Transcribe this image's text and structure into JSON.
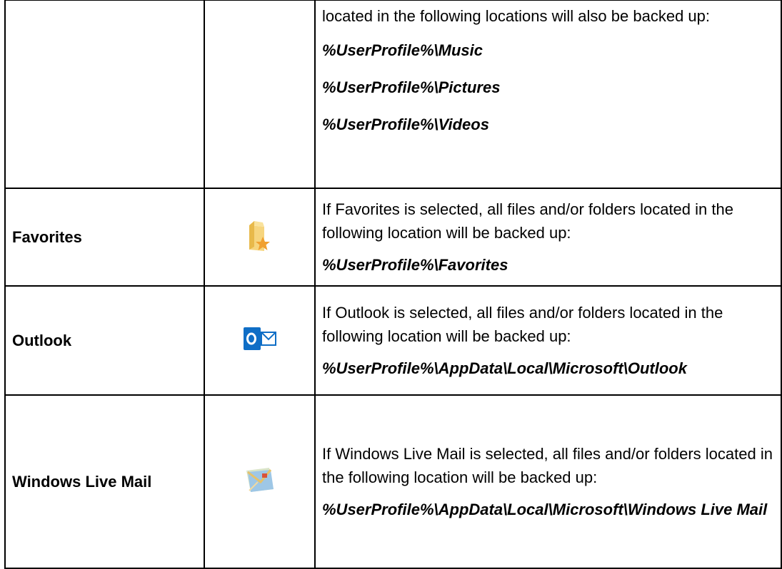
{
  "rows": [
    {
      "name": "",
      "icon": "",
      "description": "located in the following locations will also be backed up:",
      "paths": [
        "%UserProfile%\\Music",
        "%UserProfile%\\Pictures",
        "%UserProfile%\\Videos"
      ]
    },
    {
      "name": "Favorites",
      "icon": "favorites-folder-icon",
      "description": "If Favorites is selected, all files and/or folders located in the following location will be backed up:",
      "paths": [
        "%UserProfile%\\Favorites"
      ]
    },
    {
      "name": "Outlook",
      "icon": "outlook-icon",
      "description": "If Outlook is selected, all files and/or folders located in the following location will be backed up:",
      "paths": [
        "%UserProfile%\\AppData\\Local\\Microsoft\\Outlook"
      ]
    },
    {
      "name": "Windows Live Mail",
      "icon": "windows-live-mail-icon",
      "description": "If Windows Live Mail is selected, all files and/or folders located in the following location will be backed up:",
      "paths": [
        "%UserProfile%\\AppData\\Local\\Microsoft\\Windows Live Mail"
      ]
    }
  ],
  "colors": {
    "outlook_blue": "#0f6ec6",
    "folder_yellow": "#f2c660",
    "star_orange": "#f0a030"
  }
}
